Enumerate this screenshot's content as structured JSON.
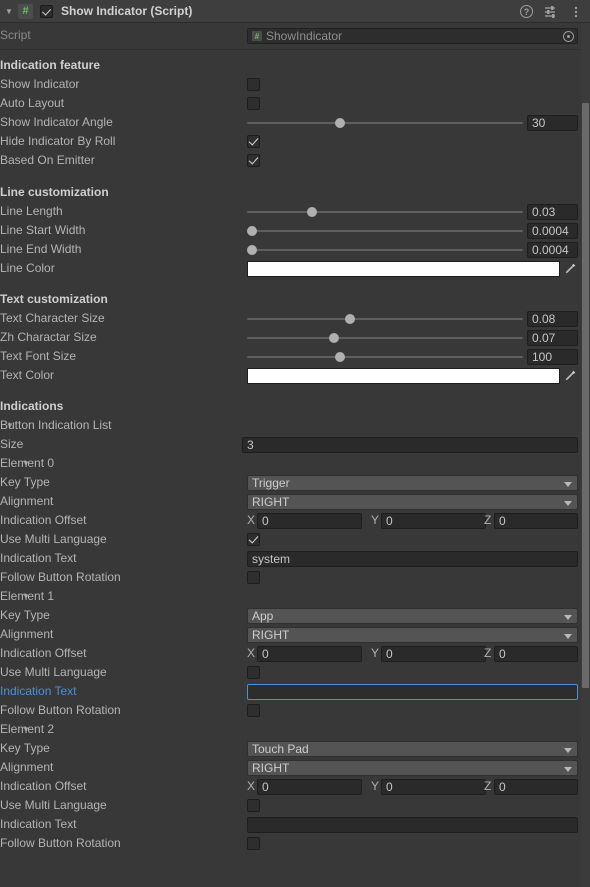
{
  "header": {
    "title": "Show Indicator (Script)",
    "enabled_checkbox": true,
    "foldout": "▼",
    "script_badge": "#",
    "icons": {
      "help": "help-icon",
      "preset": "preset-icon",
      "menu": "kebab-menu-icon"
    }
  },
  "script_row": {
    "label": "Script",
    "value": "ShowIndicator",
    "badge": "#",
    "picker": "object-picker-icon"
  },
  "sections": {
    "indication_feature": {
      "title": "Indication feature",
      "rows": [
        {
          "label": "Show Indicator",
          "type": "checkbox",
          "value": false
        },
        {
          "label": "Auto Layout",
          "type": "checkbox",
          "value": false
        },
        {
          "label": "Show Indicator Angle",
          "type": "slider",
          "value": "30",
          "knob_pct": 33
        },
        {
          "label": "Hide Indicator By Roll",
          "type": "checkbox",
          "value": true
        },
        {
          "label": "Based On Emitter",
          "type": "checkbox",
          "value": true
        }
      ]
    },
    "line_customization": {
      "title": "Line customization",
      "rows": [
        {
          "label": "Line Length",
          "type": "slider",
          "value": "0.03",
          "knob_pct": 23
        },
        {
          "label": "Line Start Width",
          "type": "slider",
          "value": "0.0004",
          "knob_pct": 2
        },
        {
          "label": "Line End Width",
          "type": "slider",
          "value": "0.0004",
          "knob_pct": 2
        },
        {
          "label": "Line Color",
          "type": "color",
          "value": "#ffffff"
        }
      ]
    },
    "text_customization": {
      "title": "Text customization",
      "rows": [
        {
          "label": "Text Character Size",
          "type": "slider",
          "value": "0.08",
          "knob_pct": 37
        },
        {
          "label": "Zh Charactar Size",
          "type": "slider",
          "value": "0.07",
          "knob_pct": 31
        },
        {
          "label": "Text Font Size",
          "type": "slider",
          "value": "100",
          "knob_pct": 33
        },
        {
          "label": "Text Color",
          "type": "color",
          "value": "#ffffff"
        }
      ]
    },
    "indications": {
      "title": "Indications",
      "list_label": "Button Indication List",
      "size_label": "Size",
      "size_value": "3",
      "elements": [
        {
          "name": "Element 0",
          "key_type_label": "Key Type",
          "key_type_value": "Trigger",
          "alignment_label": "Alignment",
          "alignment_value": "RIGHT",
          "offset_label": "Indication Offset",
          "offset": {
            "x_axis": "X",
            "x": "0",
            "y_axis": "Y",
            "y": "0",
            "z_axis": "Z",
            "z": "0"
          },
          "multi_lang_label": "Use Multi Language",
          "multi_lang_value": true,
          "text_label": "Indication Text",
          "text_value": "system",
          "text_focused": false,
          "follow_label": "Follow Button Rotation",
          "follow_value": false
        },
        {
          "name": "Element 1",
          "key_type_label": "Key Type",
          "key_type_value": "App",
          "alignment_label": "Alignment",
          "alignment_value": "RIGHT",
          "offset_label": "Indication Offset",
          "offset": {
            "x_axis": "X",
            "x": "0",
            "y_axis": "Y",
            "y": "0",
            "z_axis": "Z",
            "z": "0"
          },
          "multi_lang_label": "Use Multi Language",
          "multi_lang_value": false,
          "text_label": "Indication Text",
          "text_value": "",
          "text_focused": true,
          "follow_label": "Follow Button Rotation",
          "follow_value": false
        },
        {
          "name": "Element 2",
          "key_type_label": "Key Type",
          "key_type_value": "Touch Pad",
          "alignment_label": "Alignment",
          "alignment_value": "RIGHT",
          "offset_label": "Indication Offset",
          "offset": {
            "x_axis": "X",
            "x": "0",
            "y_axis": "Y",
            "y": "0",
            "z_axis": "Z",
            "z": "0"
          },
          "multi_lang_label": "Use Multi Language",
          "multi_lang_value": false,
          "text_label": "Indication Text",
          "text_value": "",
          "text_focused": false,
          "follow_label": "Follow Button Rotation",
          "follow_value": false
        }
      ]
    }
  },
  "colors": {
    "accent": "#4a90d9",
    "panel": "#383838",
    "header": "#3e3e3e",
    "dropdown": "#545454"
  }
}
